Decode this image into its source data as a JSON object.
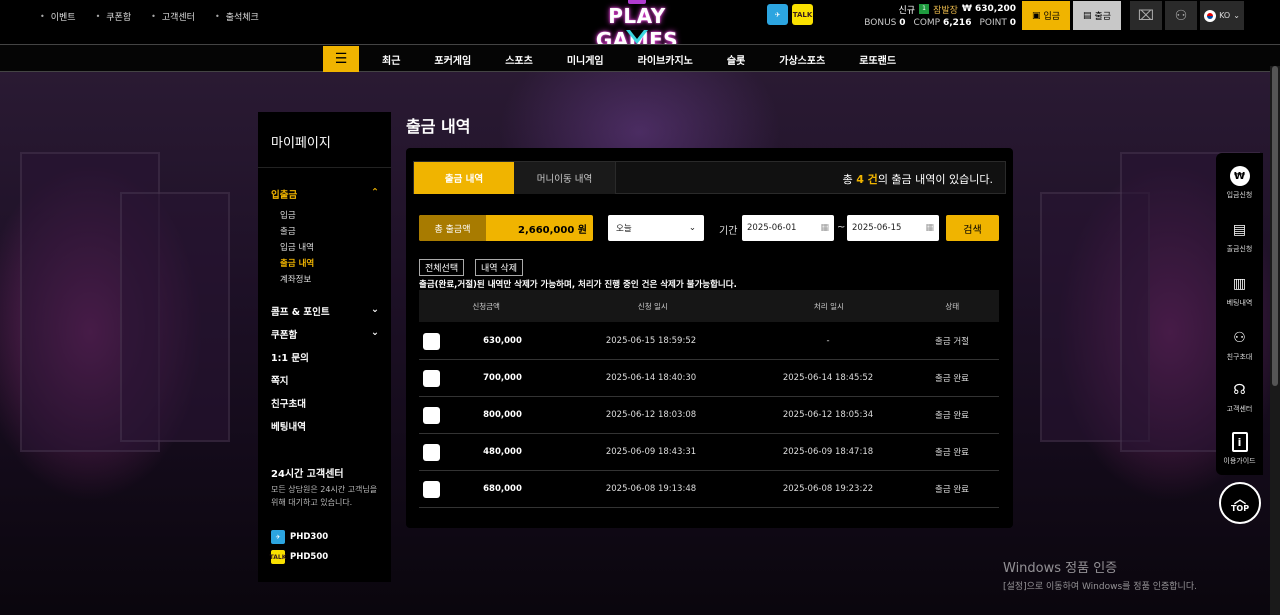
{
  "top_links": [
    "이벤트",
    "쿠폰함",
    "고객센터",
    "출석체크"
  ],
  "logo": {
    "text": "PLAY GAMES"
  },
  "social": {
    "telegram": "✈",
    "kakao": "TALK"
  },
  "user": {
    "new_label": "신규",
    "level": "1",
    "nickname": "잠발장",
    "balance": "₩ 630,200",
    "bonus_label": "BONUS",
    "bonus": "0",
    "comp_label": "COMP",
    "comp": "6,216",
    "point_label": "POINT",
    "point": "0"
  },
  "header_buttons": {
    "deposit": "입금",
    "withdraw": "출금",
    "lang": "KO"
  },
  "nav": [
    "최근",
    "포커게임",
    "스포츠",
    "미니게임",
    "라이브카지노",
    "슬롯",
    "가상스포츠",
    "로또랜드"
  ],
  "sidebar": {
    "title": "마이페이지",
    "categories": [
      {
        "label": "입출금",
        "active": true,
        "chevron": "up"
      },
      {
        "label": "콤프 & 포인트",
        "chevron": "down"
      },
      {
        "label": "쿠폰함",
        "chevron": "down"
      },
      {
        "label": "1:1 문의"
      },
      {
        "label": "쪽지"
      },
      {
        "label": "친구초대"
      },
      {
        "label": "베팅내역"
      }
    ],
    "sub_items": [
      "입금",
      "출금",
      "입금 내역",
      "출금 내역",
      "계좌정보"
    ],
    "active_sub": "출금 내역",
    "cs_title": "24시간 고객센터",
    "cs_desc": "모든 상담원은 24시간 고객님을 위해 대기하고 있습니다.",
    "contacts": [
      {
        "type": "telegram",
        "id": "PHD300"
      },
      {
        "type": "kakao",
        "id": "PHD500"
      }
    ]
  },
  "main": {
    "page_title": "출금 내역",
    "tabs": [
      "출금 내역",
      "머니이동 내역"
    ],
    "summary": {
      "prefix": "총 ",
      "count": "4 건",
      "suffix": "의 출금 내역이 있습니다."
    },
    "total_label": "총 출금액",
    "total_value": "2,660,000 원",
    "period_select": "오늘",
    "period_label": "기간",
    "date_from": "2025-06-01",
    "date_to": "2025-06-15",
    "search_label": "검색",
    "select_all": "전체선택",
    "delete_label": "내역 삭제",
    "notice": "출금(완료,거절)된 내역만 삭제가 가능하며, 처리가 진행 중인 건은 삭제가 불가능합니다.",
    "columns": [
      "신청금액",
      "신청 일시",
      "처리 일시",
      "상태"
    ],
    "rows": [
      {
        "amount": "630,000",
        "requested": "2025-06-15 18:59:52",
        "processed": "-",
        "status": "출금 거절"
      },
      {
        "amount": "700,000",
        "requested": "2025-06-14 18:40:30",
        "processed": "2025-06-14 18:45:52",
        "status": "출금 완료"
      },
      {
        "amount": "800,000",
        "requested": "2025-06-12 18:03:08",
        "processed": "2025-06-12 18:05:34",
        "status": "출금 완료"
      },
      {
        "amount": "480,000",
        "requested": "2025-06-09 18:43:31",
        "processed": "2025-06-09 18:47:18",
        "status": "출금 완료"
      },
      {
        "amount": "680,000",
        "requested": "2025-06-08 19:13:48",
        "processed": "2025-06-08 19:23:22",
        "status": "출금 완료"
      }
    ]
  },
  "right_menu": [
    {
      "icon": "won-coin-icon",
      "label": "입금신청"
    },
    {
      "icon": "withdraw-icon",
      "label": "출금신청"
    },
    {
      "icon": "document-icon",
      "label": "베팅내역"
    },
    {
      "icon": "add-user-icon",
      "label": "친구초대"
    },
    {
      "icon": "headset-icon",
      "label": "고객센터"
    },
    {
      "icon": "info-icon",
      "label": "이용가이드"
    }
  ],
  "top_button": "TOP",
  "watermark": {
    "line1": "Windows 정품 인증",
    "line2": "[설정]으로 이동하여 Windows를 정품 인증합니다."
  },
  "colors": {
    "accent": "#f0b400",
    "panel": "#000000"
  }
}
